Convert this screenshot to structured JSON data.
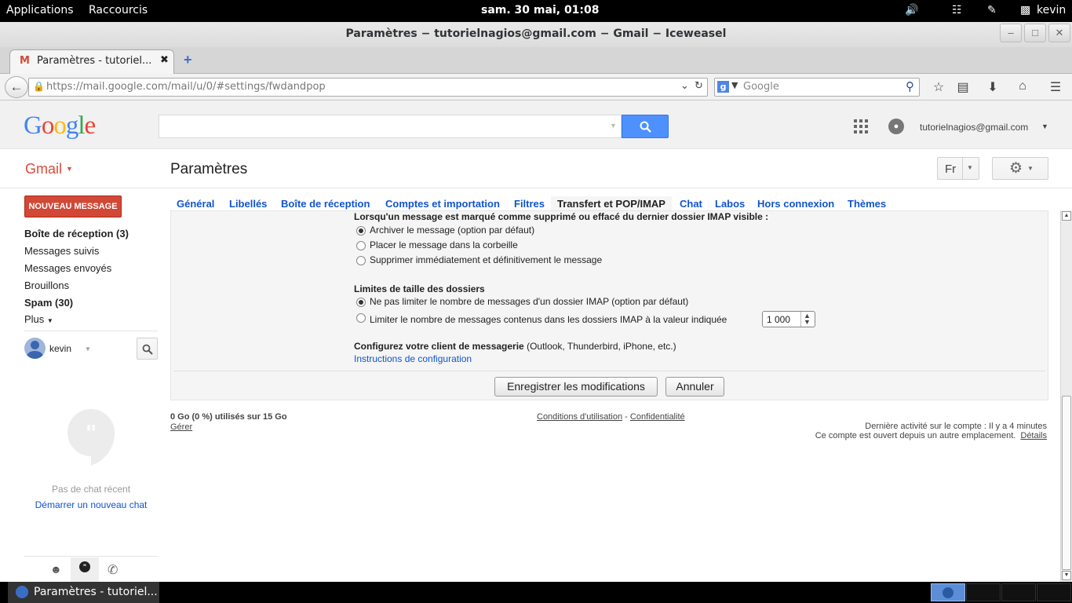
{
  "system": {
    "applications": "Applications",
    "shortcuts": "Raccourcis",
    "clock": "sam. 30 mai, 01:08",
    "user": "kevin"
  },
  "window": {
    "title": "Paramètres − tutorielnagios@gmail.com − Gmail − Iceweasel"
  },
  "browser": {
    "tab_label": "Paramètres - tutoriel...",
    "url": "https://mail.google.com/mail/u/0/#settings/fwdandpop",
    "search_placeholder": "Google"
  },
  "gmail": {
    "logo": "Google",
    "account_email": "tutorielnagios@gmail.com",
    "gmail_label": "Gmail",
    "page_title": "Paramètres",
    "lang_button": "Fr",
    "compose": "NOUVEAU MESSAGE",
    "nav": [
      {
        "label": "Boîte de réception (3)",
        "bold": true
      },
      {
        "label": "Messages suivis",
        "bold": false
      },
      {
        "label": "Messages envoyés",
        "bold": false
      },
      {
        "label": "Brouillons",
        "bold": false
      },
      {
        "label": "Spam (30)",
        "bold": true
      },
      {
        "label": "Plus",
        "bold": false
      }
    ],
    "chat_user": "kevin",
    "no_chat": "Pas de chat récent",
    "start_chat": "Démarrer un nouveau chat"
  },
  "tabs": [
    "Général",
    "Libellés",
    "Boîte de réception",
    "Comptes et importation",
    "Filtres",
    "Transfert et POP/IMAP",
    "Chat",
    "Labos",
    "Hors connexion",
    "Thèmes"
  ],
  "settings": {
    "expunge_heading": "Lorsqu'un message est marqué comme supprimé ou effacé du dernier dossier IMAP visible :",
    "expunge_options": [
      "Archiver le message (option par défaut)",
      "Placer le message dans la corbeille",
      "Supprimer immédiatement et définitivement le message"
    ],
    "expunge_selected": 0,
    "folder_heading": "Limites de taille des dossiers",
    "folder_options": [
      "Ne pas limiter le nombre de messages d'un dossier IMAP (option par défaut)",
      "Limiter le nombre de messages contenus dans les dossiers IMAP à la valeur indiquée"
    ],
    "folder_selected": 0,
    "folder_limit_value": "1 000",
    "client_heading": "Configurez votre client de messagerie",
    "client_examples": "(Outlook, Thunderbird, iPhone, etc.)",
    "client_link": "Instructions de configuration",
    "save": "Enregistrer les modifications",
    "cancel": "Annuler"
  },
  "footer": {
    "storage": "0 Go (0 %) utilisés sur 15 Go",
    "manage": "Gérer",
    "terms": "Conditions d'utilisation",
    "sep": "-",
    "privacy": "Confidentialité",
    "last_activity": "Dernière activité sur le compte : Il y a 4 minutes",
    "other_location": "Ce compte est ouvert depuis un autre emplacement.",
    "details": "Détails"
  },
  "taskbar": {
    "item": "Paramètres - tutoriel..."
  },
  "colors": {
    "compose_red": "#d14836",
    "link_blue": "#15c",
    "search_blue": "#4d90fe"
  }
}
